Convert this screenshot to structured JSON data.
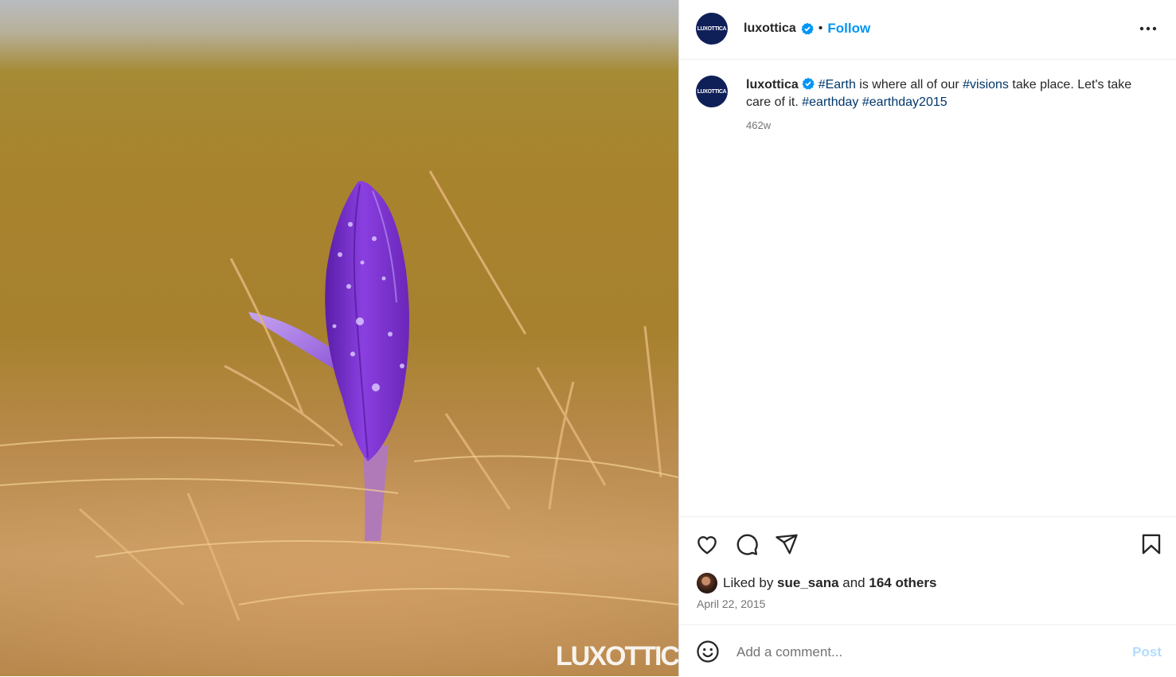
{
  "post": {
    "media_alt": "Purple crocus bud with water drops among dry grass",
    "watermark": "LUXOTTICA",
    "author": {
      "username": "luxottica",
      "avatar_text": "LUXOTTICA",
      "verified": true,
      "follow_label": "Follow",
      "separator": "•"
    },
    "more_icon": "more-options-icon",
    "caption": {
      "username": "luxottica",
      "tag1": "#Earth",
      "text1": " is where all of our ",
      "tag2": "#visions",
      "text2": " take place. Let's take care of it. ",
      "tag3": "#earthday",
      "text3": " ",
      "tag4": "#earthday2015",
      "time_ago": "462w"
    },
    "actions": {
      "like_icon": "heart-icon",
      "comment_icon": "comment-icon",
      "share_icon": "share-icon",
      "save_icon": "bookmark-icon"
    },
    "likes": {
      "prefix": "Liked by ",
      "user": "sue_sana",
      "mid": " and ",
      "others": "164 others"
    },
    "date": "April 22, 2015",
    "comment": {
      "emoji_icon": "emoji-icon",
      "placeholder": "Add a comment...",
      "post_label": "Post"
    }
  },
  "colors": {
    "accent": "#0095f6",
    "hashtag": "#00376b",
    "muted": "#737373",
    "avatar_bg": "#0f1f57",
    "flower": "#7a2fd0"
  }
}
